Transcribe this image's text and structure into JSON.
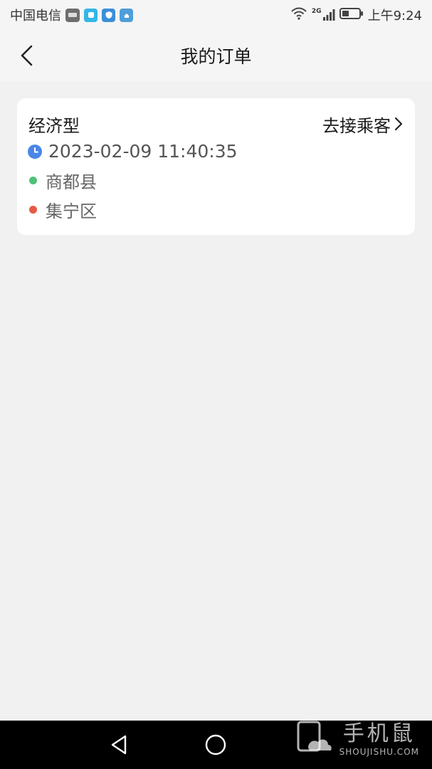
{
  "status_bar": {
    "carrier": "中国电信",
    "network": "2G",
    "time": "上午9:24",
    "icons": [
      "app-badge-icon",
      "app-cyan-icon",
      "app-shield-icon",
      "app-cloud-icon",
      "wifi-icon",
      "signal-icon",
      "battery-icon"
    ]
  },
  "header": {
    "back_icon": "chevron-left-icon",
    "title": "我的订单"
  },
  "order": {
    "car_type": "经济型",
    "action_label": "去接乘客",
    "datetime": "2023-02-09 11:40:35",
    "origin": "商都县",
    "destination": "集宁区",
    "colors": {
      "clock": "#4a86e8",
      "origin_dot": "#4fc27a",
      "destination_dot": "#e35b43"
    }
  },
  "nav_bar": {
    "icons": [
      "back-triangle-icon",
      "home-circle-icon"
    ]
  },
  "watermark": {
    "cn": "手机鼠",
    "en": "SHOUJISHU.COM"
  }
}
